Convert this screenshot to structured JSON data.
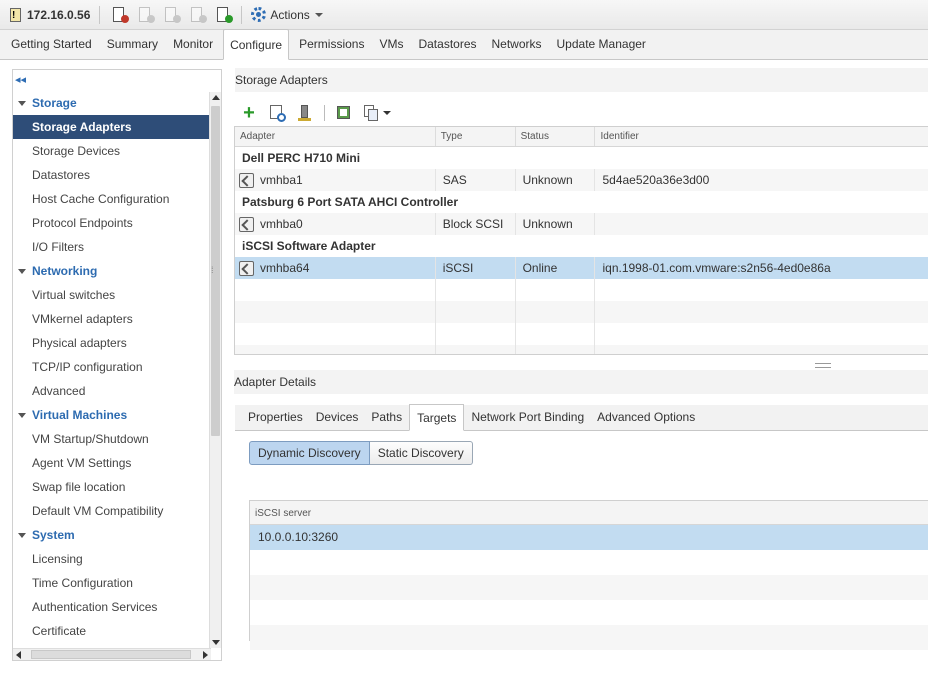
{
  "toolbar": {
    "host_name": "172.16.0.56",
    "actions_label": "Actions",
    "icons": [
      "host-warning-icon",
      "exit-maintenance-icon",
      "shutdown-icon",
      "suspend-icon",
      "power-icon",
      "reboot-icon",
      "gear-icon"
    ]
  },
  "main_tabs": [
    {
      "label": "Getting Started"
    },
    {
      "label": "Summary"
    },
    {
      "label": "Monitor"
    },
    {
      "label": "Configure",
      "active": true
    },
    {
      "label": "Permissions"
    },
    {
      "label": "VMs"
    },
    {
      "label": "Datastores"
    },
    {
      "label": "Networks"
    },
    {
      "label": "Update Manager"
    }
  ],
  "nav": {
    "collapse_glyph": "◂◂",
    "groups": [
      {
        "label": "Storage",
        "items": [
          "Storage Adapters",
          "Storage Devices",
          "Datastores",
          "Host Cache Configuration",
          "Protocol Endpoints",
          "I/O Filters"
        ]
      },
      {
        "label": "Networking",
        "items": [
          "Virtual switches",
          "VMkernel adapters",
          "Physical adapters",
          "TCP/IP configuration",
          "Advanced"
        ]
      },
      {
        "label": "Virtual Machines",
        "items": [
          "VM Startup/Shutdown",
          "Agent VM Settings",
          "Swap file location",
          "Default VM Compatibility"
        ]
      },
      {
        "label": "System",
        "items": [
          "Licensing",
          "Time Configuration",
          "Authentication Services",
          "Certificate"
        ]
      }
    ],
    "selected": "Storage Adapters"
  },
  "storage_adapters": {
    "title": "Storage Adapters",
    "columns": [
      "Adapter",
      "Type",
      "Status",
      "Identifier"
    ],
    "groups": [
      {
        "name": "Dell PERC H710 Mini",
        "adapters": [
          {
            "adapter": "vmhba1",
            "type": "SAS",
            "status": "Unknown",
            "identifier": "5d4ae520a36e3d00"
          }
        ]
      },
      {
        "name": "Patsburg 6 Port SATA AHCI Controller",
        "adapters": [
          {
            "adapter": "vmhba0",
            "type": "Block SCSI",
            "status": "Unknown",
            "identifier": ""
          }
        ]
      },
      {
        "name": "iSCSI Software Adapter",
        "adapters": [
          {
            "adapter": "vmhba64",
            "type": "iSCSI",
            "status": "Online",
            "identifier": "iqn.1998-01.com.vmware:s2n56-4ed0e86a",
            "selected": true
          }
        ]
      }
    ]
  },
  "adapter_details": {
    "title": "Adapter Details",
    "tabs": [
      "Properties",
      "Devices",
      "Paths",
      "Targets",
      "Network Port Binding",
      "Advanced Options"
    ],
    "active_tab": "Targets",
    "discovery": {
      "dynamic_label": "Dynamic Discovery",
      "static_label": "Static Discovery",
      "active": "Dynamic Discovery"
    },
    "iscsi_table": {
      "header": "iSCSI server",
      "rows": [
        "10.0.0.10:3260"
      ]
    }
  },
  "colors": {
    "nav_selected_bg": "#2e4d78",
    "nav_group_text": "#2d6bb0",
    "row_selected_bg": "#c2dcf1",
    "accent_green": "#2a9a2a"
  }
}
